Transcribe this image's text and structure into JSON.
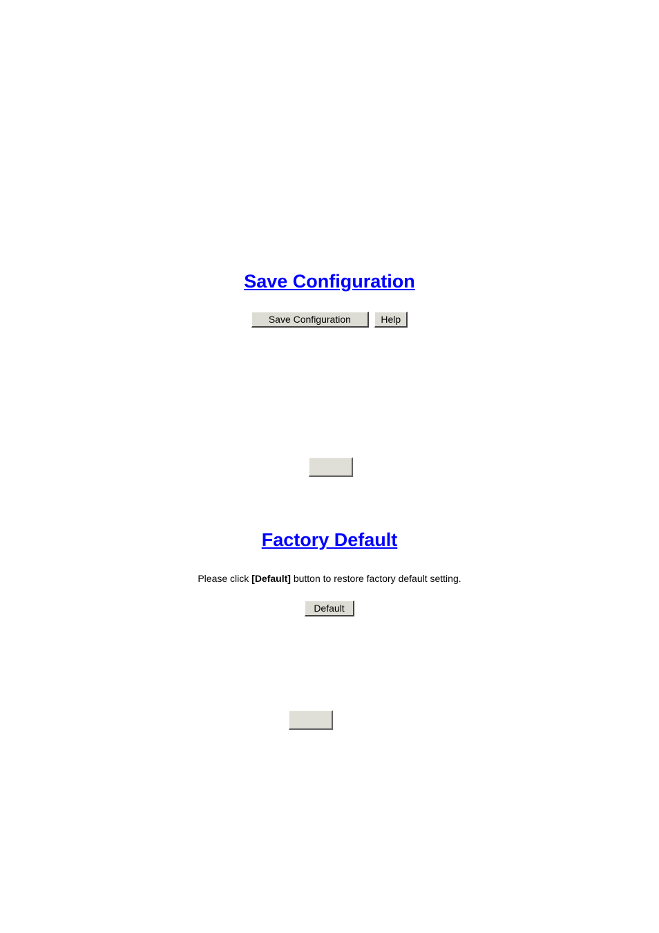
{
  "saveSection": {
    "heading": "Save Configuration",
    "saveButtonLabel": "Save Configuration",
    "helpButtonLabel": "Help"
  },
  "factorySection": {
    "heading": "Factory Default",
    "instructionPrefix": "Please click ",
    "instructionBold": "[Default]",
    "instructionSuffix": " button to restore factory default setting.",
    "defaultButtonLabel": "Default"
  }
}
